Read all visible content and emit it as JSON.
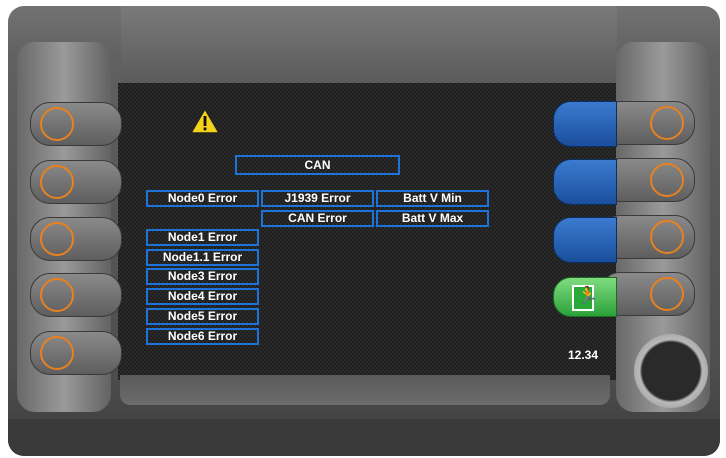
{
  "screen": {
    "warning_icon": "warning-triangle-icon",
    "title": "CAN",
    "errors": [
      "Node0 Error",
      "J1939 Error",
      "Batt V Min",
      "CAN Error",
      "Batt V Max",
      "Node1 Error",
      "Node1.1 Error",
      "Node3 Error",
      "Node4 Error",
      "Node5 Error",
      "Node6 Error"
    ],
    "version": "12.34",
    "exit_icon": "emergency-exit-icon"
  },
  "colors": {
    "cell_border": "#1e73d9",
    "softkey_blue": "#2a64b8",
    "softkey_green": "#2ba23a",
    "button_ring": "#e8811f"
  }
}
